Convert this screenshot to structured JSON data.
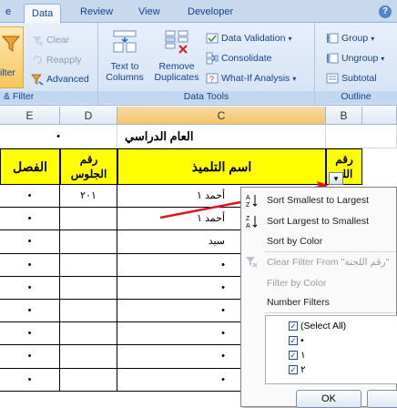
{
  "tabs": [
    {
      "label": "e"
    },
    {
      "label": "Data"
    },
    {
      "label": "Review"
    },
    {
      "label": "View"
    },
    {
      "label": "Developer"
    }
  ],
  "ribbon": {
    "sort_filter": {
      "filter_label": "ilter",
      "clear": "Clear",
      "reapply": "Reapply",
      "advanced": "Advanced",
      "group_label": "& Filter"
    },
    "data_tools": {
      "text_to_columns": "Text to Columns",
      "remove_duplicates": "Remove Duplicates",
      "data_validation": "Data Validation",
      "consolidate": "Consolidate",
      "whatif": "What-If Analysis",
      "group_label": "Data Tools"
    },
    "outline": {
      "group": "Group",
      "ungroup": "Ungroup",
      "subtotal": "Subtotal",
      "group_label": "Outline"
    }
  },
  "columns": [
    "E",
    "D",
    "C",
    "B"
  ],
  "sheet": {
    "title": "العام الدراسي",
    "title_dot": "•",
    "headers": {
      "e": "الفصل",
      "d": "رقم الجلوس",
      "c": "اسم التلميذ",
      "b": "رقم اللج"
    },
    "rows": [
      {
        "e": "•",
        "d": "٢٠١",
        "c": "أحمد ١"
      },
      {
        "e": "•",
        "d": "",
        "c": "أحمد ١"
      },
      {
        "e": "•",
        "d": "",
        "c": "سيد"
      },
      {
        "e": "•",
        "d": "",
        "c": "•"
      },
      {
        "e": "•",
        "d": "",
        "c": "•"
      },
      {
        "e": "•",
        "d": "",
        "c": "•"
      },
      {
        "e": "•",
        "d": "",
        "c": "•"
      },
      {
        "e": "•",
        "d": "",
        "c": "•"
      },
      {
        "e": "•",
        "d": "",
        "c": "•"
      }
    ]
  },
  "filter_menu": {
    "sort_asc": "Sort Smallest to Largest",
    "sort_desc": "Sort Largest to Smallest",
    "sort_color": "Sort by Color",
    "clear_filter": "Clear Filter From \"رقم اللجنة\"",
    "filter_color": "Filter by Color",
    "number_filters": "Number Filters",
    "options": [
      {
        "label": "(Select All)",
        "checked": true
      },
      {
        "label": "•",
        "checked": true
      },
      {
        "label": "١",
        "checked": true
      },
      {
        "label": "٢",
        "checked": true
      }
    ],
    "ok": "OK"
  },
  "colors": {
    "header_yellow": "#ffff00",
    "arrow_red": "#e0141e",
    "ribbon_blue": "#15428b"
  }
}
